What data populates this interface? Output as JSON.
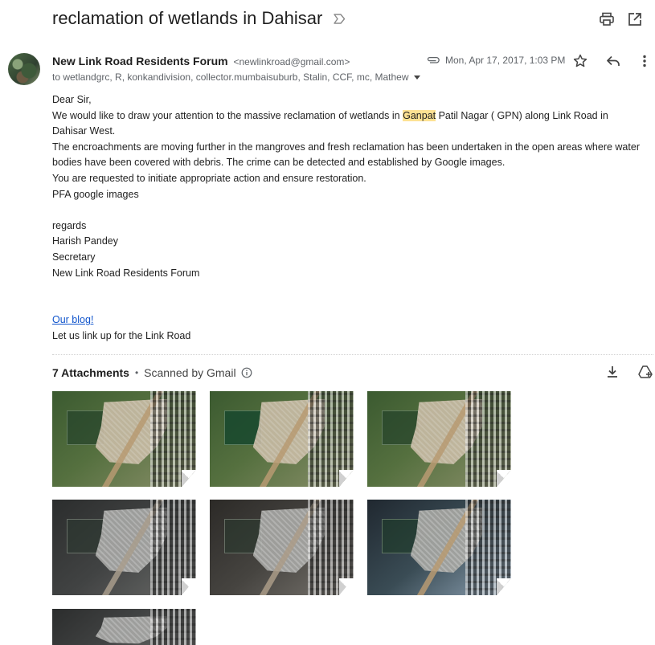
{
  "subject": "reclamation of wetlands in Dahisar",
  "top_actions": {
    "print": "print-icon",
    "open_new": "open-new-window-icon"
  },
  "message": {
    "sender_name": "New Link Road Residents Forum",
    "sender_email": "<newlinkroad@gmail.com>",
    "date": "Mon, Apr 17, 2017, 1:03 PM",
    "recipients": "to wetlandgrc, R, konkandivision, collector.mumbaisuburb, Stalin, CCF, mc, Mathew",
    "actions": {
      "star": "star-icon",
      "reply": "reply-icon",
      "more": "more-vert-icon"
    }
  },
  "body": {
    "greeting": "Dear Sir,",
    "p1_before": "We would like to draw your attention to the massive reclamation of wetlands in ",
    "p1_highlight": "Ganpat",
    "p1_after": " Patil Nagar ( GPN) along Link Road in Dahisar West.",
    "p2": "The encroachments are moving further in the mangroves and fresh reclamation has been undertaken in the open areas where water bodies have been covered with debris. The crime can be detected and established by Google images.",
    "p3": "You are requested to initiate appropriate action and ensure restoration.",
    "p4": "PFA google images",
    "regards": "regards",
    "sig_name": "Harish Pandey",
    "sig_title": "Secretary",
    "sig_org": "New Link Road Residents Forum",
    "blog_link": "Our blog!",
    "tagline": "Let us link up for the Link Road"
  },
  "attachments": {
    "count_label": "7 Attachments",
    "separator": "•",
    "scanned_label": "Scanned by Gmail",
    "actions": {
      "download_all": "download-icon",
      "add_to_drive": "add-to-drive-icon"
    },
    "items": [
      {
        "name": "attachment-1"
      },
      {
        "name": "attachment-2"
      },
      {
        "name": "attachment-3"
      },
      {
        "name": "attachment-4"
      },
      {
        "name": "attachment-5"
      },
      {
        "name": "attachment-6"
      },
      {
        "name": "attachment-7"
      }
    ]
  },
  "colors": {
    "link": "#1155cc",
    "highlight": "#fde293",
    "muted": "#5f6368"
  }
}
